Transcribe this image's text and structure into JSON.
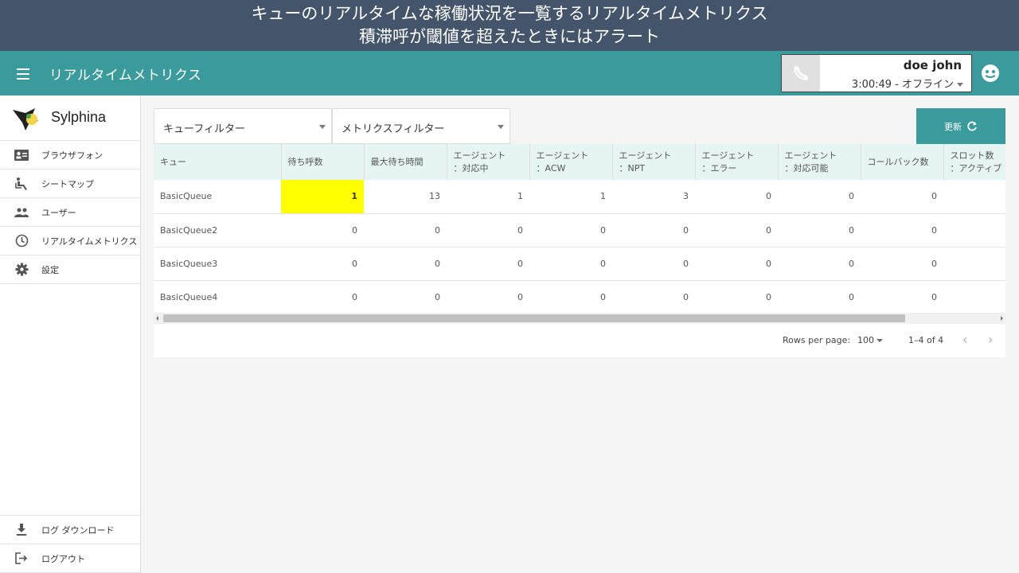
{
  "caption": {
    "line1": "キューのリアルタイムな稼働状況を一覧するリアルタイムメトリクス",
    "line2": "積滞呼が閾値を超えたときにはアラート"
  },
  "appbar": {
    "title": "リアルタイムメトリクス",
    "agent_name": "doe john",
    "agent_status": "3:00:49 - オフライン"
  },
  "sidebar": {
    "logo": "Sylphina",
    "items": [
      {
        "label": "ブラウザフォン",
        "icon": "contact-card-icon"
      },
      {
        "label": "シートマップ",
        "icon": "seat-icon"
      },
      {
        "label": "ユーザー",
        "icon": "users-icon"
      },
      {
        "label": "リアルタイムメトリクス",
        "icon": "clock-icon"
      },
      {
        "label": "設定",
        "icon": "gear-icon"
      }
    ],
    "bottom_items": [
      {
        "label": "ログ ダウンロード",
        "icon": "download-icon"
      },
      {
        "label": "ログアウト",
        "icon": "logout-icon"
      }
    ]
  },
  "filters": {
    "queue": "キューフィルター",
    "metrics": "メトリクスフィルター"
  },
  "refresh_label": "更新",
  "table": {
    "columns": [
      [
        "キュー",
        ""
      ],
      [
        "待ち呼数",
        ""
      ],
      [
        "最大待ち時間",
        ""
      ],
      [
        "エージェント",
        "：対応中"
      ],
      [
        "エージェント",
        "：ACW"
      ],
      [
        "エージェント",
        "：NPT"
      ],
      [
        "エージェント",
        "：エラー"
      ],
      [
        "エージェント",
        "：対応可能"
      ],
      [
        "コールバック数",
        ""
      ],
      [
        "スロット数",
        "：アクティブ"
      ]
    ],
    "rows": [
      [
        "BasicQueue",
        "1",
        "13",
        "1",
        "1",
        "3",
        "0",
        "0",
        "0"
      ],
      [
        "BasicQueue2",
        "0",
        "0",
        "0",
        "0",
        "0",
        "0",
        "0",
        "0"
      ],
      [
        "BasicQueue3",
        "0",
        "0",
        "0",
        "0",
        "0",
        "0",
        "0",
        "0"
      ],
      [
        "BasicQueue4",
        "0",
        "0",
        "0",
        "0",
        "0",
        "0",
        "0",
        "0"
      ]
    ],
    "highlight_color": "#ffff00"
  },
  "pagination": {
    "rows_per_page_label": "Rows per page:",
    "rows_per_page": "100",
    "range": "1–4 of 4"
  },
  "colors": {
    "accent": "#3b9a9c",
    "caption_bg": "#44546a"
  }
}
